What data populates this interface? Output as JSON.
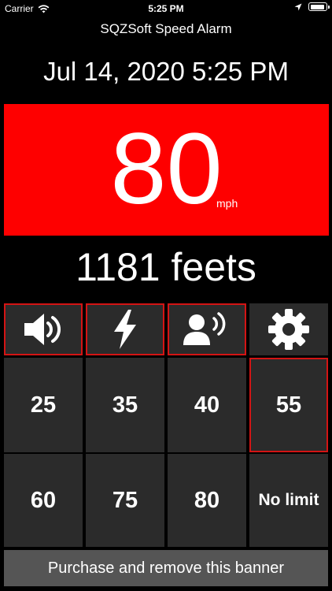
{
  "status": {
    "carrier": "Carrier",
    "time": "5:25 PM",
    "battery_level": 1.0,
    "wifi_icon": "wifi-icon",
    "location_icon": "location-arrow-icon",
    "battery_icon": "battery-icon"
  },
  "app": {
    "title": "SQZSoft Speed Alarm"
  },
  "datetime": "Jul 14, 2020 5:25 PM",
  "speed": {
    "value": "80",
    "unit": "mph",
    "background_color": "#fe0000"
  },
  "distance": "1181 feets",
  "toolbar": {
    "sound_icon": "speaker-icon",
    "flash_icon": "lightning-icon",
    "voice_icon": "voice-person-icon",
    "settings_icon": "gear-icon"
  },
  "limits": [
    "25",
    "35",
    "40",
    "55",
    "60",
    "75",
    "80",
    "No limit"
  ],
  "selected_limit": "55",
  "banner": {
    "label": "Purchase and remove this banner"
  },
  "colors": {
    "accent_red": "#d41414",
    "cell_bg": "#2b2b2b",
    "banner_bg": "#555555"
  }
}
